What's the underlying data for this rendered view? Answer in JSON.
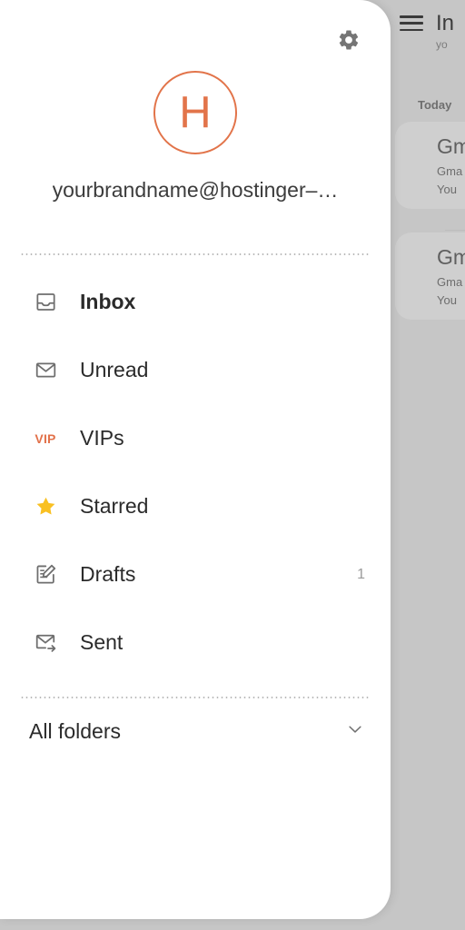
{
  "colors": {
    "accent_orange": "#e2744a",
    "star_yellow": "#f9c022",
    "backdrop_gray": "#c6c6c6",
    "drawer_white": "#ffffff",
    "text_primary": "#2b2b2b",
    "text_muted": "#9a9a9a"
  },
  "drawer": {
    "settings_icon": "gear-icon",
    "account": {
      "avatar_letter": "H",
      "email": "yourbrandname@hostinger–…"
    },
    "folders": [
      {
        "icon": "inbox-tray-icon",
        "label": "Inbox",
        "count": "",
        "active": true
      },
      {
        "icon": "envelope-icon",
        "label": "Unread",
        "count": "",
        "active": false
      },
      {
        "icon": "vip-text-icon",
        "label": "VIPs",
        "count": "",
        "active": false,
        "badge": "VIP"
      },
      {
        "icon": "star-icon",
        "label": "Starred",
        "count": "",
        "active": false
      },
      {
        "icon": "draft-pencil-icon",
        "label": "Drafts",
        "count": "1",
        "active": false
      },
      {
        "icon": "sent-arrow-icon",
        "label": "Sent",
        "count": "",
        "active": false
      }
    ],
    "all_folders": {
      "label": "All folders",
      "expand_icon": "chevron-down-icon"
    }
  },
  "background": {
    "menu_icon": "hamburger-menu-icon",
    "title": "In",
    "subtitle": "yo",
    "section_label": "Today",
    "messages": [
      {
        "sender": "Gm",
        "subject": "Gma",
        "preview": "You"
      },
      {
        "sender": "Gm",
        "subject": "Gma",
        "preview": "You"
      }
    ]
  }
}
